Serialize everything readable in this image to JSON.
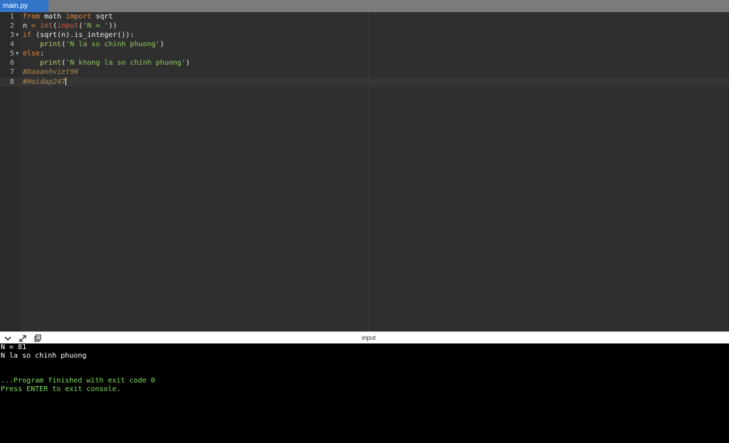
{
  "tab": {
    "filename": "main.py"
  },
  "editor": {
    "line_numbers": [
      "1",
      "2",
      "3",
      "4",
      "5",
      "6",
      "7",
      "8"
    ],
    "lines": [
      [
        {
          "t": "from",
          "c": "kw"
        },
        {
          "t": " math ",
          "c": "pl"
        },
        {
          "t": "import",
          "c": "kw"
        },
        {
          "t": " sqrt",
          "c": "pl"
        }
      ],
      [
        {
          "t": "n ",
          "c": "pl"
        },
        {
          "t": "=",
          "c": "kw"
        },
        {
          "t": " ",
          "c": "pl"
        },
        {
          "t": "int",
          "c": "bi"
        },
        {
          "t": "(",
          "c": "pl"
        },
        {
          "t": "input",
          "c": "bi"
        },
        {
          "t": "(",
          "c": "pl"
        },
        {
          "t": "'N = '",
          "c": "st"
        },
        {
          "t": "))",
          "c": "pl"
        }
      ],
      [
        {
          "t": "if",
          "c": "kw"
        },
        {
          "t": " (sqrt(n).is_integer()):",
          "c": "pl"
        }
      ],
      [
        {
          "t": "    ",
          "c": "pl"
        },
        {
          "t": "print",
          "c": "fn"
        },
        {
          "t": "(",
          "c": "pl"
        },
        {
          "t": "'N la so chinh phuong'",
          "c": "st"
        },
        {
          "t": ")",
          "c": "pl"
        }
      ],
      [
        {
          "t": "else",
          "c": "kw"
        },
        {
          "t": ":",
          "c": "pl"
        }
      ],
      [
        {
          "t": "    ",
          "c": "pl"
        },
        {
          "t": "print",
          "c": "fn"
        },
        {
          "t": "(",
          "c": "pl"
        },
        {
          "t": "'N khong la so chinh phuong'",
          "c": "st"
        },
        {
          "t": ")",
          "c": "pl"
        }
      ],
      [
        {
          "t": "#Daoanhviet96",
          "c": "cm"
        }
      ],
      [
        {
          "t": "#Hoidap247",
          "c": "cm"
        }
      ]
    ]
  },
  "console": {
    "title": "input",
    "output_lines": [
      {
        "t": "N = 81",
        "c": "con-white"
      },
      {
        "t": "N la so chinh phuong",
        "c": "con-white"
      },
      {
        "t": "",
        "c": "con-white"
      },
      {
        "t": "",
        "c": "con-white"
      },
      {
        "t": "...Program finished with exit code 0",
        "c": "con-green"
      },
      {
        "t": "Press ENTER to exit console.",
        "c": "con-green"
      }
    ]
  },
  "icons": {
    "collapse": "chevron-down-icon",
    "expand": "expand-icon",
    "copy": "copy-icon"
  },
  "colors": {
    "tab_active": "#3275c8",
    "editor_bg": "#2f2f2f",
    "console_bg": "#000000",
    "console_green": "#7fe05a"
  }
}
